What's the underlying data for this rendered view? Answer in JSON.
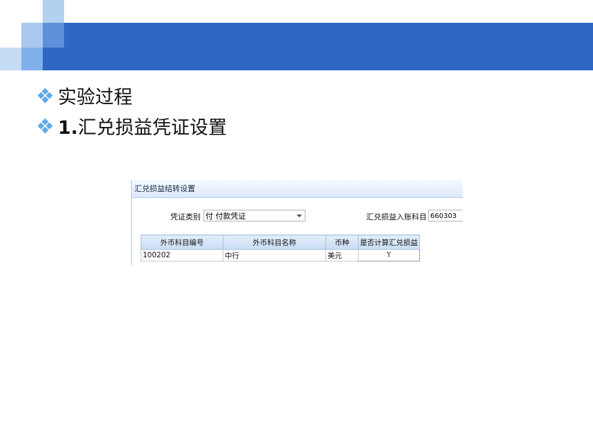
{
  "bullets": [
    {
      "text": "实验过程"
    },
    {
      "number": "1.",
      "text": "汇兑损益凭证设置"
    }
  ],
  "dialog": {
    "title": "汇兑损益结转设置",
    "voucher_type_label": "凭证类别",
    "voucher_type_value": "付 付款凭证",
    "account_label": "汇兑损益入账科目",
    "account_value": "660303",
    "table": {
      "headers": [
        "外币科目编号",
        "外币科目名称",
        "币种",
        "是否计算汇兑损益"
      ],
      "rows": [
        [
          "100202",
          "中行",
          "美元",
          "Y"
        ]
      ]
    }
  }
}
